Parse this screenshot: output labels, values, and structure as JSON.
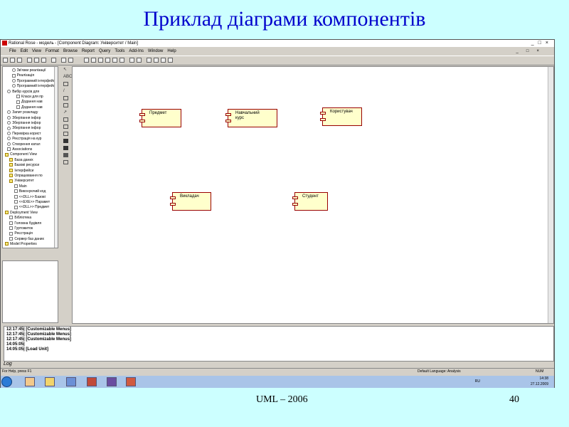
{
  "slide": {
    "title": "Приклад діаграми компонентів",
    "footer_left": "UML – 2006",
    "page_number": "40"
  },
  "window": {
    "title": "Rational Rose - модель - [Component Diagram: Університет / Main]",
    "controls": [
      "_",
      "□",
      "×"
    ]
  },
  "menu": [
    "File",
    "Edit",
    "View",
    "Format",
    "Browse",
    "Report",
    "Query",
    "Tools",
    "Add-Ins",
    "Window",
    "Help"
  ],
  "browser": {
    "items": [
      {
        "label": "Зв'язки реалізації",
        "icon": "use-case-icon"
      },
      {
        "label": "Реалізація",
        "icon": "component-icon"
      },
      {
        "label": "Програмний інтерфейс",
        "icon": "use-case-icon"
      },
      {
        "label": "Програмний інтерфейс",
        "icon": "use-case-icon"
      },
      {
        "label": "Вибір курсів для",
        "icon": "use-case-icon"
      },
      {
        "label": "Класи для пр",
        "icon": "component-icon"
      },
      {
        "label": "Додання нав",
        "icon": "component-icon"
      },
      {
        "label": "Додання нав",
        "icon": "component-icon"
      },
      {
        "label": "Запит розкладу",
        "icon": "use-case-icon"
      },
      {
        "label": "Зберігання інфор",
        "icon": "use-case-icon"
      },
      {
        "label": "Зберігання інфор",
        "icon": "use-case-icon"
      },
      {
        "label": "Зберігання інфор",
        "icon": "use-case-icon"
      },
      {
        "label": "Перевірка корист",
        "icon": "use-case-icon"
      },
      {
        "label": "Реєстрація на кур",
        "icon": "use-case-icon"
      },
      {
        "label": "Створення катал",
        "icon": "use-case-icon"
      },
      {
        "label": "Associations",
        "icon": "component-icon"
      },
      {
        "label": "Component View",
        "icon": "folder-icon"
      },
      {
        "label": "База даних",
        "icon": "folder-icon"
      },
      {
        "label": "Базові ресурси",
        "icon": "folder-icon"
      },
      {
        "label": "Інтерфейси",
        "icon": "folder-icon"
      },
      {
        "label": "Опрацювання по",
        "icon": "folder-icon"
      },
      {
        "label": "Університет",
        "icon": "folder-icon"
      },
      {
        "label": "Main",
        "icon": "component-icon"
      },
      {
        "label": "Виконуючий код",
        "icon": "component-icon"
      },
      {
        "label": "<<DLL>> Базові",
        "icon": "component-icon"
      },
      {
        "label": "<<EXE>> Парамет",
        "icon": "component-icon"
      },
      {
        "label": "<<DLL>> Предмет",
        "icon": "component-icon"
      },
      {
        "label": "Deployment View",
        "icon": "folder-icon"
      },
      {
        "label": "Бібліотека",
        "icon": "component-icon"
      },
      {
        "label": "Головна будівля",
        "icon": "component-icon"
      },
      {
        "label": "Гуртожиток",
        "icon": "component-icon"
      },
      {
        "label": "Реєстрація",
        "icon": "component-icon"
      },
      {
        "label": "Сервер баз даних",
        "icon": "component-icon"
      },
      {
        "label": "Model Properties",
        "icon": "folder-icon"
      }
    ]
  },
  "diagram": {
    "components": [
      {
        "name": "Предмет"
      },
      {
        "name": "Навчальний курс"
      },
      {
        "name": "Користувач"
      },
      {
        "name": "Викладач"
      },
      {
        "name": "Студент"
      }
    ]
  },
  "log": {
    "lines": [
      "12:17:45|  [Customizable Menus]",
      "12:17:45|  [Customizable Menus]",
      "12:17:45|  [Customizable Menus]",
      "14:05:05|",
      "14:05:05|  [Load Unit]"
    ],
    "tab_label": "Log"
  },
  "status": {
    "help": "For Help, press F1",
    "language": "Default Language: Analysis",
    "numlock": "NUM"
  },
  "taskbar": {
    "lang": "RU",
    "time": "14:38",
    "date": "27.12.2009"
  }
}
